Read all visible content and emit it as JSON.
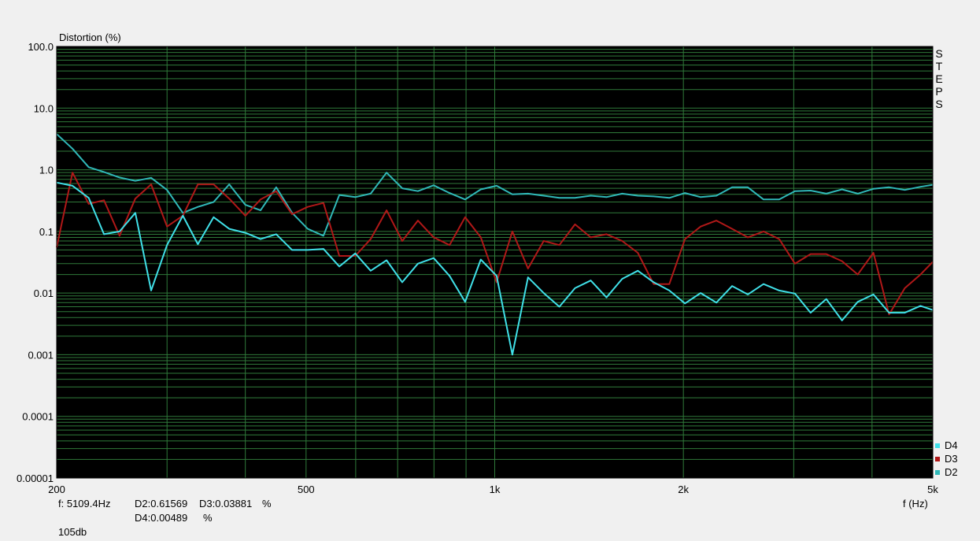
{
  "y_axis_title": "Distortion (%)",
  "x_axis_title": "f (Hz)",
  "mode_label": "STEPS",
  "readout": {
    "frequency": "f: 5109.4Hz",
    "d2": "D2:0.61569",
    "d3": "D3:0.03881",
    "unit1": "%",
    "d4": "D4:0.00489",
    "unit2": "%"
  },
  "level": "105db",
  "colors": {
    "background": "#000000",
    "grid": "#2f7a3a",
    "d2": "#30b8b8",
    "d3": "#b01818",
    "d4": "#40e0e8"
  },
  "chart_data": {
    "type": "line",
    "xscale": "log",
    "yscale": "log",
    "xlim": [
      200,
      5000
    ],
    "ylim": [
      1e-05,
      100
    ],
    "grid": true,
    "legend_position": "bottom-right",
    "xticks": [
      {
        "value": 200,
        "label": "200"
      },
      {
        "value": 500,
        "label": "500"
      },
      {
        "value": 1000,
        "label": "1k"
      },
      {
        "value": 2000,
        "label": "2k"
      },
      {
        "value": 5000,
        "label": "5k"
      }
    ],
    "yticks": [
      {
        "value": 100,
        "label": "100.0"
      },
      {
        "value": 10,
        "label": "10.0"
      },
      {
        "value": 1,
        "label": "1.0"
      },
      {
        "value": 0.1,
        "label": "0.1"
      },
      {
        "value": 0.01,
        "label": "0.01"
      },
      {
        "value": 0.001,
        "label": "0.001"
      },
      {
        "value": 0.0001,
        "label": "0.0001"
      },
      {
        "value": 1e-05,
        "label": "0.00001"
      }
    ],
    "legend": [
      "D4",
      "D3",
      "D2"
    ],
    "series": [
      {
        "name": "D2",
        "color": "#30b8b8",
        "x": [
          200,
          212,
          225,
          238,
          252,
          267,
          283,
          300,
          318,
          336,
          356,
          377,
          400,
          423,
          448,
          475,
          503,
          533,
          565,
          599,
          634,
          672,
          712,
          754,
          799,
          847,
          897,
          950,
          1007,
          1067,
          1130,
          1197,
          1268,
          1343,
          1423,
          1508,
          1597,
          1692,
          1793,
          1899,
          2012,
          2131,
          2258,
          2392,
          2534,
          2685,
          2844,
          3013,
          3192,
          3381,
          3582,
          3795,
          4020,
          4259,
          4512,
          4780,
          5000
        ],
        "y": [
          3.8,
          2.2,
          1.1,
          0.92,
          0.75,
          0.66,
          0.74,
          0.47,
          0.2,
          0.25,
          0.3,
          0.58,
          0.27,
          0.22,
          0.52,
          0.2,
          0.11,
          0.085,
          0.39,
          0.36,
          0.41,
          0.9,
          0.5,
          0.45,
          0.56,
          0.42,
          0.33,
          0.48,
          0.55,
          0.4,
          0.41,
          0.38,
          0.35,
          0.35,
          0.38,
          0.36,
          0.41,
          0.38,
          0.37,
          0.35,
          0.42,
          0.36,
          0.38,
          0.52,
          0.52,
          0.33,
          0.33,
          0.45,
          0.46,
          0.41,
          0.48,
          0.41,
          0.49,
          0.52,
          0.47,
          0.53,
          0.57
        ]
      },
      {
        "name": "D3",
        "color": "#b01818",
        "x": [
          200,
          212,
          225,
          238,
          252,
          267,
          283,
          300,
          318,
          336,
          356,
          377,
          400,
          423,
          448,
          475,
          503,
          533,
          565,
          599,
          634,
          672,
          712,
          754,
          799,
          847,
          897,
          950,
          1007,
          1067,
          1130,
          1197,
          1268,
          1343,
          1423,
          1508,
          1597,
          1692,
          1793,
          1899,
          2012,
          2131,
          2258,
          2392,
          2534,
          2685,
          2844,
          3013,
          3192,
          3381,
          3582,
          3795,
          4020,
          4259,
          4512,
          4780,
          5000
        ],
        "y": [
          0.055,
          0.9,
          0.28,
          0.32,
          0.085,
          0.34,
          0.58,
          0.12,
          0.18,
          0.58,
          0.58,
          0.34,
          0.18,
          0.33,
          0.45,
          0.19,
          0.25,
          0.29,
          0.04,
          0.04,
          0.075,
          0.22,
          0.07,
          0.15,
          0.08,
          0.06,
          0.17,
          0.08,
          0.015,
          0.1,
          0.025,
          0.07,
          0.06,
          0.13,
          0.08,
          0.09,
          0.07,
          0.045,
          0.014,
          0.014,
          0.075,
          0.12,
          0.15,
          0.11,
          0.08,
          0.1,
          0.075,
          0.03,
          0.043,
          0.043,
          0.033,
          0.02,
          0.045,
          0.0045,
          0.012,
          0.02,
          0.032
        ]
      },
      {
        "name": "D4",
        "color": "#40e0e8",
        "x": [
          200,
          212,
          225,
          238,
          252,
          267,
          283,
          300,
          318,
          336,
          356,
          377,
          400,
          423,
          448,
          475,
          503,
          533,
          565,
          599,
          634,
          672,
          712,
          754,
          799,
          847,
          897,
          950,
          1007,
          1067,
          1130,
          1197,
          1268,
          1343,
          1423,
          1508,
          1597,
          1692,
          1793,
          1899,
          2012,
          2131,
          2258,
          2392,
          2534,
          2685,
          2844,
          3013,
          3192,
          3381,
          3582,
          3795,
          4020,
          4259,
          4512,
          4780,
          5000
        ],
        "y": [
          0.62,
          0.55,
          0.35,
          0.09,
          0.1,
          0.2,
          0.011,
          0.06,
          0.18,
          0.062,
          0.17,
          0.11,
          0.095,
          0.075,
          0.09,
          0.05,
          0.05,
          0.052,
          0.027,
          0.044,
          0.023,
          0.034,
          0.015,
          0.03,
          0.037,
          0.019,
          0.0072,
          0.035,
          0.019,
          0.001,
          0.018,
          0.01,
          0.006,
          0.012,
          0.016,
          0.0085,
          0.017,
          0.023,
          0.015,
          0.011,
          0.0068,
          0.01,
          0.007,
          0.013,
          0.0095,
          0.014,
          0.011,
          0.0098,
          0.0048,
          0.008,
          0.0036,
          0.0072,
          0.0095,
          0.0048,
          0.0048,
          0.0062,
          0.0053
        ]
      }
    ]
  }
}
